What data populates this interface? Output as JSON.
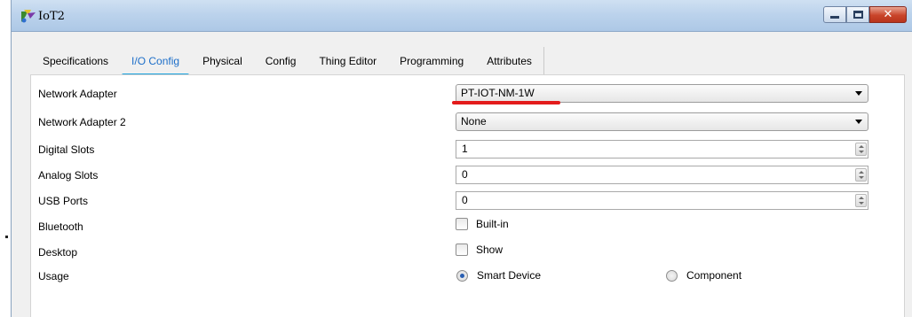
{
  "window": {
    "title": "IoT2",
    "app_icon": "iot-device-icon",
    "controls": [
      "minimize-icon",
      "maximize-icon",
      "close-icon"
    ],
    "close_glyph": "✕"
  },
  "tabs": [
    {
      "label": "Specifications",
      "active": false
    },
    {
      "label": "I/O Config",
      "active": true
    },
    {
      "label": "Physical",
      "active": false
    },
    {
      "label": "Config",
      "active": false
    },
    {
      "label": "Thing Editor",
      "active": false
    },
    {
      "label": "Programming",
      "active": false
    },
    {
      "label": "Attributes",
      "active": false
    }
  ],
  "fields": {
    "network_adapter": {
      "label": "Network Adapter",
      "value": "PT-IOT-NM-1W"
    },
    "network_adapter_2": {
      "label": "Network Adapter 2",
      "value": "None"
    },
    "digital_slots": {
      "label": "Digital Slots",
      "value": "1"
    },
    "analog_slots": {
      "label": "Analog Slots",
      "value": "0"
    },
    "usb_ports": {
      "label": "USB Ports",
      "value": "0"
    },
    "bluetooth": {
      "label": "Bluetooth",
      "option": "Built-in",
      "checked": false
    },
    "desktop": {
      "label": "Desktop",
      "option": "Show",
      "checked": false
    },
    "usage": {
      "label": "Usage",
      "options": [
        {
          "label": "Smart Device",
          "selected": true
        },
        {
          "label": "Component",
          "selected": false
        }
      ]
    }
  },
  "colors": {
    "active_tab": "#1d6fc9",
    "tab_underline": "#1ba3de",
    "annotation_underline": "#e31b1b"
  }
}
